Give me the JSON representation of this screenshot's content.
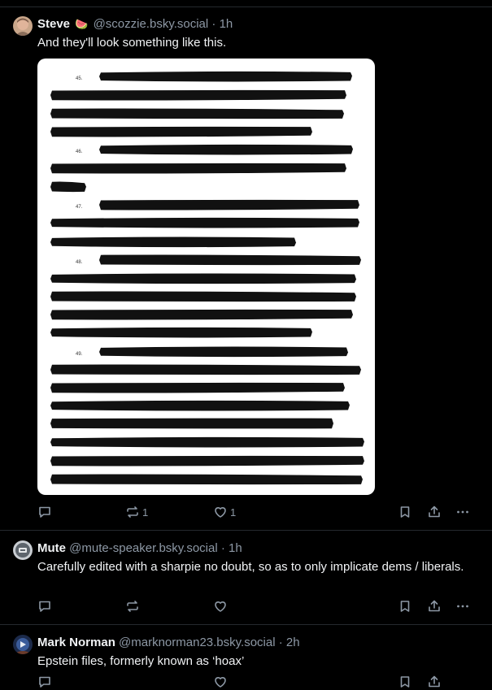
{
  "posts": [
    {
      "author_name": "Steve",
      "author_emoji": "🍉",
      "handle": "@scozzie.bsky.social",
      "time": "· 1h",
      "text": "And they'll look something like this.",
      "image": {
        "paragraph_numbers": [
          "45.",
          "46.",
          "47.",
          "48.",
          "49."
        ]
      },
      "actions": {
        "reply_count": "",
        "repost_count": "1",
        "like_count": "1"
      },
      "icons": [
        "reply-icon",
        "repost-icon",
        "like-icon",
        "bookmark-icon",
        "share-icon",
        "more-icon"
      ]
    },
    {
      "author_name": "Mute",
      "handle": "@mute-speaker.bsky.social",
      "time": "· 1h",
      "text": "Carefully edited with a sharpie no doubt, so as to only implicate dems / liberals.",
      "actions": {
        "reply_count": "",
        "repost_count": "",
        "like_count": ""
      }
    },
    {
      "author_name": "Mark Norman",
      "handle": "@marknorman23.bsky.social",
      "time": "· 2h",
      "text": "Epstein files, formerly known as ‘hoax’",
      "actions": {
        "reply_count": "",
        "repost_count": "",
        "like_count": ""
      }
    }
  ],
  "colors": {
    "background": "#000000",
    "text": "#f1f3f5",
    "muted": "#8d98a5",
    "separator": "#25292e",
    "redaction": "#111111"
  }
}
